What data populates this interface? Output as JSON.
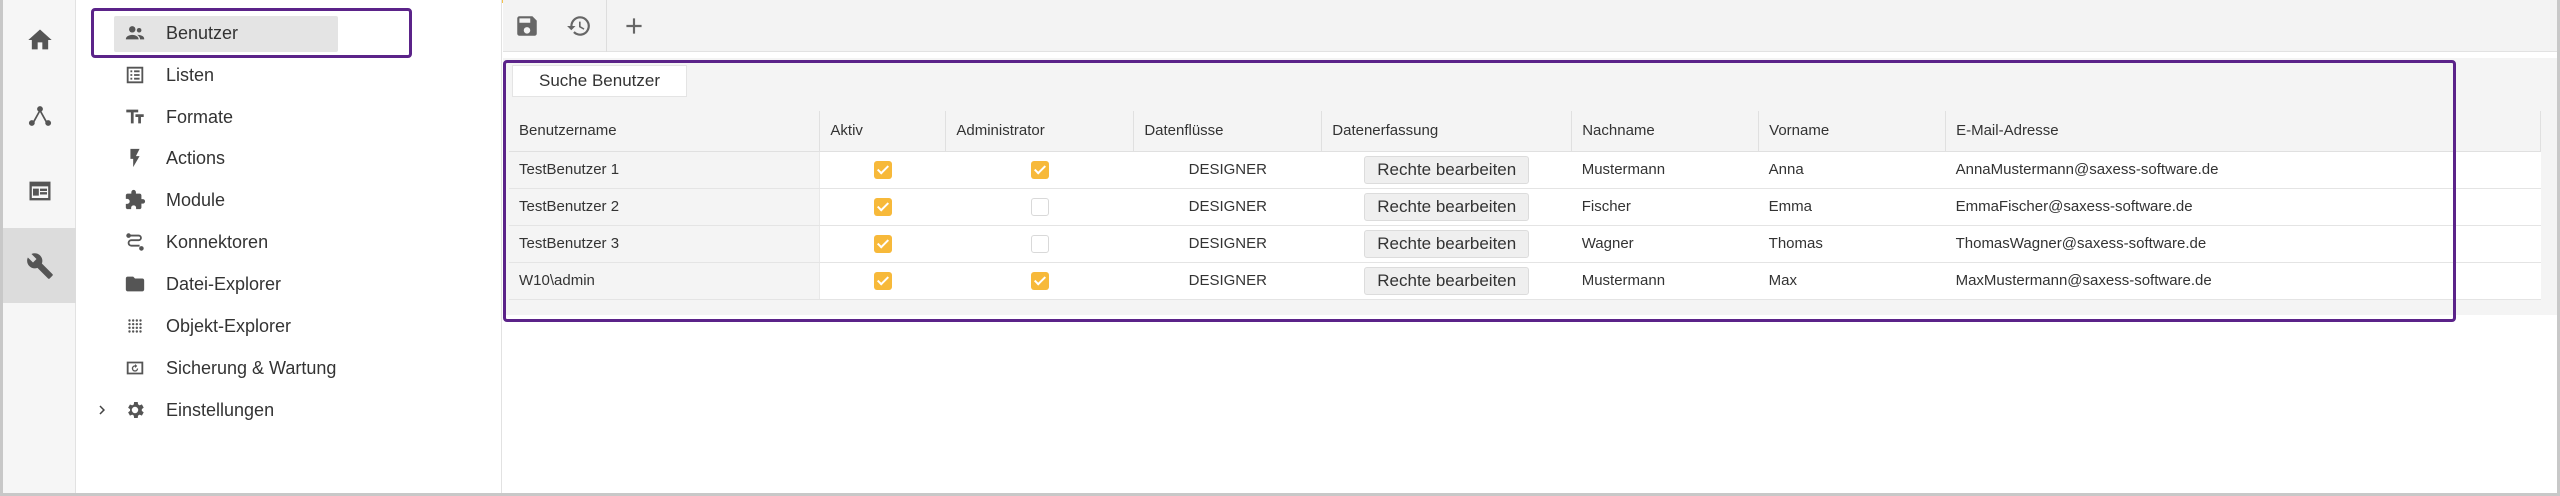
{
  "rail": {
    "items": [
      {
        "icon": "home-icon"
      },
      {
        "icon": "dataflow-icon"
      },
      {
        "icon": "form-icon"
      },
      {
        "icon": "wrench-icon"
      }
    ]
  },
  "nav": {
    "items": [
      {
        "label": "Benutzer",
        "icon": "users-icon"
      },
      {
        "label": "Listen",
        "icon": "list-icon"
      },
      {
        "label": "Formate",
        "icon": "text-format-icon"
      },
      {
        "label": "Actions",
        "icon": "lightning-icon"
      },
      {
        "label": "Module",
        "icon": "puzzle-icon"
      },
      {
        "label": "Konnektoren",
        "icon": "connector-icon"
      },
      {
        "label": "Datei-Explorer",
        "icon": "folder-icon"
      },
      {
        "label": "Objekt-Explorer",
        "icon": "dots-grid-icon"
      },
      {
        "label": "Sicherung & Wartung",
        "icon": "backup-icon"
      },
      {
        "label": "Einstellungen",
        "icon": "gear-icon"
      }
    ]
  },
  "toolbar": {
    "save_icon": "save-icon",
    "reset_icon": "history-icon",
    "add_icon": "plus-icon"
  },
  "search": {
    "label": "Suche Benutzer"
  },
  "table": {
    "headers": [
      "Benutzername",
      "Aktiv",
      "Administrator",
      "Datenflüsse",
      "Datenerfassung",
      "Nachname",
      "Vorname",
      "E-Mail-Adresse"
    ],
    "rows": [
      {
        "username": "TestBenutzer 1",
        "aktiv": true,
        "admin": true,
        "datenfluesse": "DESIGNER",
        "datenerfassung": "Rechte bearbeiten",
        "nachname": "Mustermann",
        "vorname": "Anna",
        "email": "AnnaMustermann@saxess-software.de"
      },
      {
        "username": "TestBenutzer 2",
        "aktiv": true,
        "admin": false,
        "datenfluesse": "DESIGNER",
        "datenerfassung": "Rechte bearbeiten",
        "nachname": "Fischer",
        "vorname": "Emma",
        "email": "EmmaFischer@saxess-software.de"
      },
      {
        "username": "TestBenutzer 3",
        "aktiv": true,
        "admin": false,
        "datenfluesse": "DESIGNER",
        "datenerfassung": "Rechte bearbeiten",
        "nachname": "Wagner",
        "vorname": "Thomas",
        "email": "ThomasWagner@saxess-software.de"
      },
      {
        "username": "W10\\admin",
        "aktiv": true,
        "admin": true,
        "datenfluesse": "DESIGNER",
        "datenerfassung": "Rechte bearbeiten",
        "nachname": "Mustermann",
        "vorname": "Max",
        "email": "MaxMustermann@saxess-software.de"
      }
    ]
  },
  "colors": {
    "accent": "#f7b93a",
    "highlight": "#5b2389",
    "topline": "#f5c24b"
  }
}
